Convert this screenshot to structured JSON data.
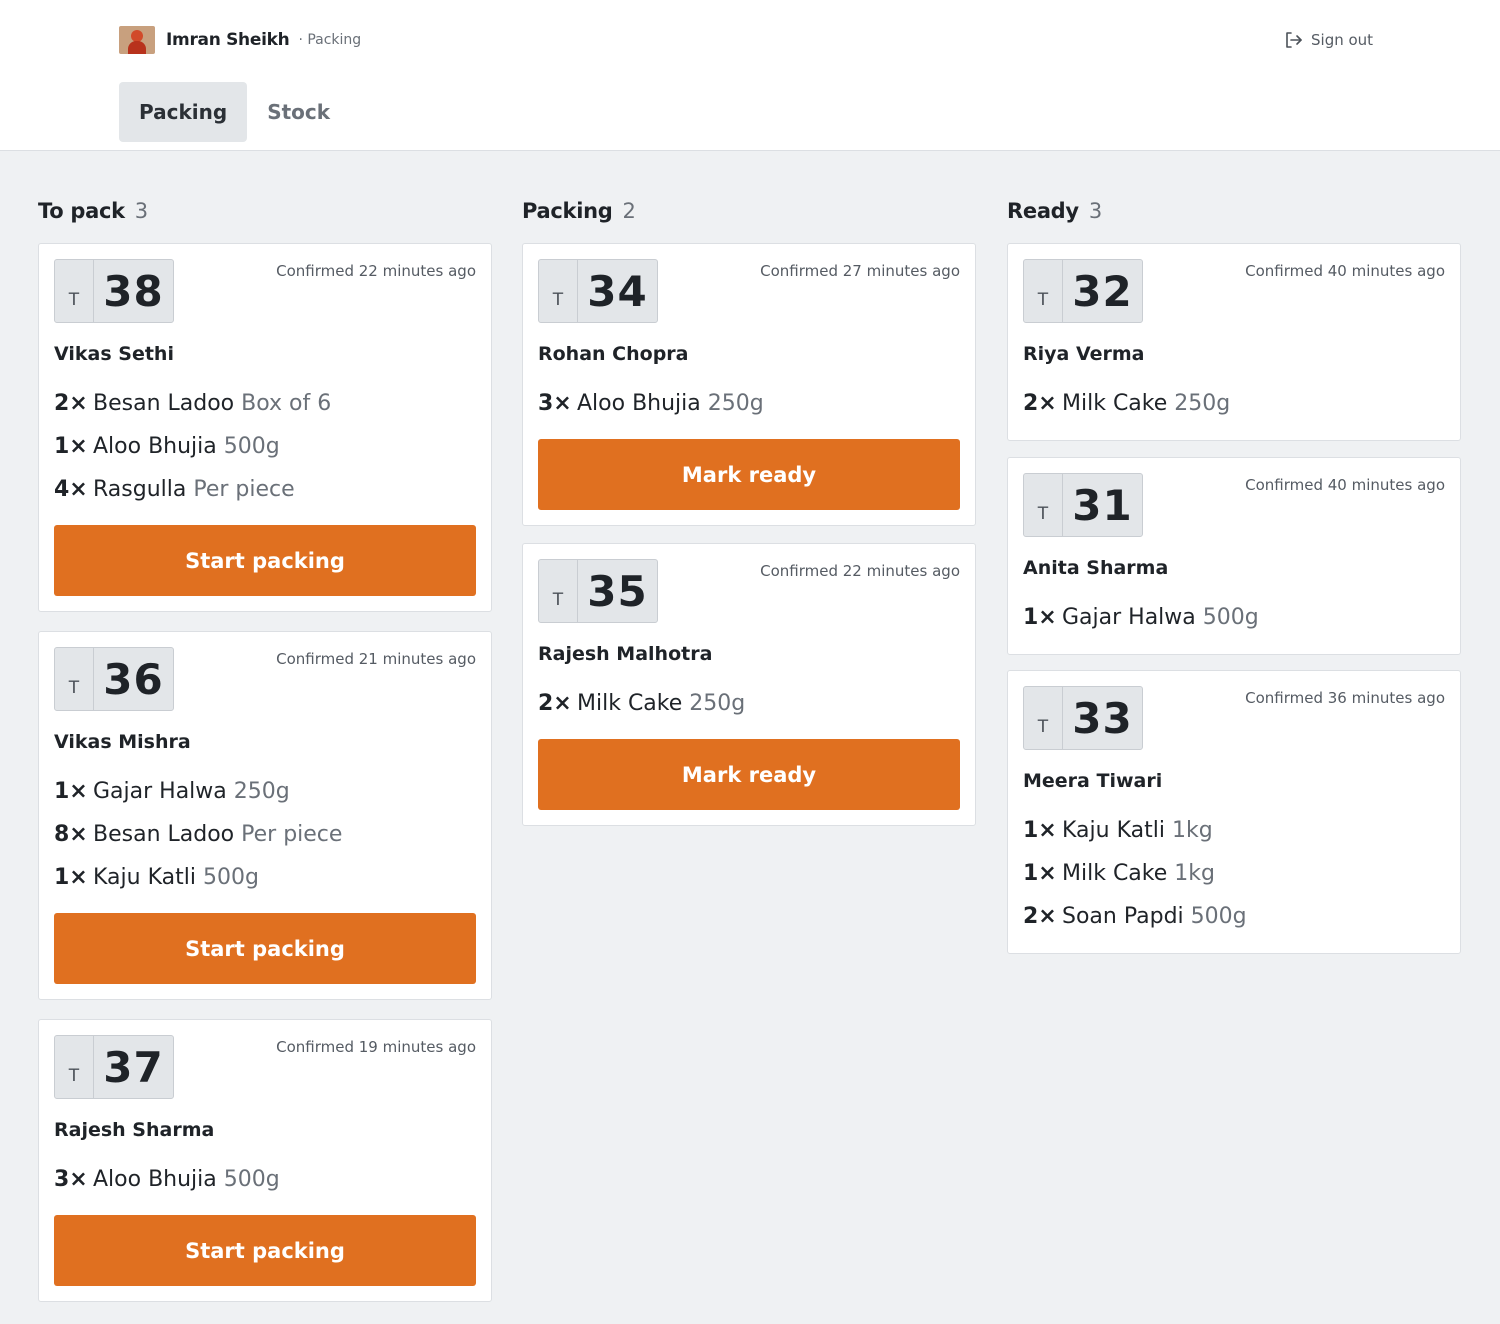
{
  "header": {
    "user_name": "Imran Sheikh",
    "user_role": "· Packing",
    "sign_out": "Sign out"
  },
  "tabs": [
    {
      "label": "Packing",
      "active": true
    },
    {
      "label": "Stock",
      "active": false
    }
  ],
  "ticket_prefix": "T",
  "colors": {
    "accent": "#e07020",
    "background": "#eff1f3"
  },
  "columns": [
    {
      "title": "To pack",
      "count": "3",
      "cards": [
        {
          "ticket": "38",
          "confirmed": "Confirmed 22 minutes ago",
          "customer": "Vikas Sethi",
          "items": [
            {
              "qty": "2×",
              "name": "Besan Ladoo",
              "variant": "Box of 6"
            },
            {
              "qty": "1×",
              "name": "Aloo Bhujia",
              "variant": "500g"
            },
            {
              "qty": "4×",
              "name": "Rasgulla",
              "variant": "Per piece"
            }
          ],
          "action": "Start packing"
        },
        {
          "ticket": "36",
          "confirmed": "Confirmed 21 minutes ago",
          "customer": "Vikas Mishra",
          "items": [
            {
              "qty": "1×",
              "name": "Gajar Halwa",
              "variant": "250g"
            },
            {
              "qty": "8×",
              "name": "Besan Ladoo",
              "variant": "Per piece"
            },
            {
              "qty": "1×",
              "name": "Kaju Katli",
              "variant": "500g"
            }
          ],
          "action": "Start packing"
        },
        {
          "ticket": "37",
          "confirmed": "Confirmed 19 minutes ago",
          "customer": "Rajesh Sharma",
          "items": [
            {
              "qty": "3×",
              "name": "Aloo Bhujia",
              "variant": "500g"
            }
          ],
          "action": "Start packing"
        }
      ]
    },
    {
      "title": "Packing",
      "count": "2",
      "cards": [
        {
          "ticket": "34",
          "confirmed": "Confirmed 27 minutes ago",
          "customer": "Rohan Chopra",
          "items": [
            {
              "qty": "3×",
              "name": "Aloo Bhujia",
              "variant": "250g"
            }
          ],
          "action": "Mark ready"
        },
        {
          "ticket": "35",
          "confirmed": "Confirmed 22 minutes ago",
          "customer": "Rajesh Malhotra",
          "items": [
            {
              "qty": "2×",
              "name": "Milk Cake",
              "variant": "250g"
            }
          ],
          "action": "Mark ready"
        }
      ]
    },
    {
      "title": "Ready",
      "count": "3",
      "cards": [
        {
          "ticket": "32",
          "confirmed": "Confirmed 40 minutes ago",
          "customer": "Riya Verma",
          "items": [
            {
              "qty": "2×",
              "name": "Milk Cake",
              "variant": "250g"
            }
          ]
        },
        {
          "ticket": "31",
          "confirmed": "Confirmed 40 minutes ago",
          "customer": "Anita Sharma",
          "items": [
            {
              "qty": "1×",
              "name": "Gajar Halwa",
              "variant": "500g"
            }
          ]
        },
        {
          "ticket": "33",
          "confirmed": "Confirmed 36 minutes ago",
          "customer": "Meera Tiwari",
          "items": [
            {
              "qty": "1×",
              "name": "Kaju Katli",
              "variant": "1kg"
            },
            {
              "qty": "1×",
              "name": "Milk Cake",
              "variant": "1kg"
            },
            {
              "qty": "2×",
              "name": "Soan Papdi",
              "variant": "500g"
            }
          ]
        }
      ]
    }
  ]
}
